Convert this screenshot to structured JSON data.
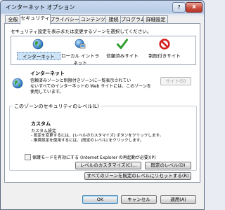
{
  "window": {
    "title": "インターネット オプション",
    "help_glyph": "?",
    "close_glyph": "x"
  },
  "tabs": [
    {
      "label": "全般"
    },
    {
      "label": "セキュリティ"
    },
    {
      "label": "プライバシー"
    },
    {
      "label": "コンテンツ"
    },
    {
      "label": "接続"
    },
    {
      "label": "プログラム"
    },
    {
      "label": "詳細設定"
    }
  ],
  "security": {
    "instruction": "セキュリティ設定を表示または変更するゾーンを選択してください。",
    "zones": [
      {
        "label": "インターネット",
        "icon": "globe-icon"
      },
      {
        "label": "ローカル イントラネット",
        "icon": "intranet-icon"
      },
      {
        "label": "信頼済みサイト",
        "icon": "checkmark-icon"
      },
      {
        "label": "制限付きサイト",
        "icon": "prohibited-icon"
      }
    ],
    "selected_zone": {
      "title": "インターネット",
      "desc_lines": [
        "信頼済みゾーンと制限付きゾーンに一覧表示されてい",
        "ないすべてのインターネットの Web サイトには、このゾーンを",
        "使用しています。"
      ]
    },
    "sites_button": "サイト(S)",
    "level_group_title": "このゾーンのセキュリティのレベル(L)",
    "level": {
      "title": "カスタム",
      "lines": [
        "カスタム設定",
        "- 設定を変更するには、[レベルのカスタマイズ] ボタンをクリックします。",
        "- 推奨設定を使用するには、[既定のレベル] をクリックします。"
      ]
    },
    "protected_mode_label": "保護モードを有効にする (Internet Explorer の再起動が必要)(P)",
    "custom_level_button": "レベルのカスタマイズ(C)...",
    "default_level_button": "既定のレベル(D)",
    "reset_all_button": "すべてのゾーンを既定のレベルにリセットする(R)"
  },
  "footer": {
    "ok": "OK",
    "cancel": "キャンセル",
    "apply": "適用(A)"
  }
}
